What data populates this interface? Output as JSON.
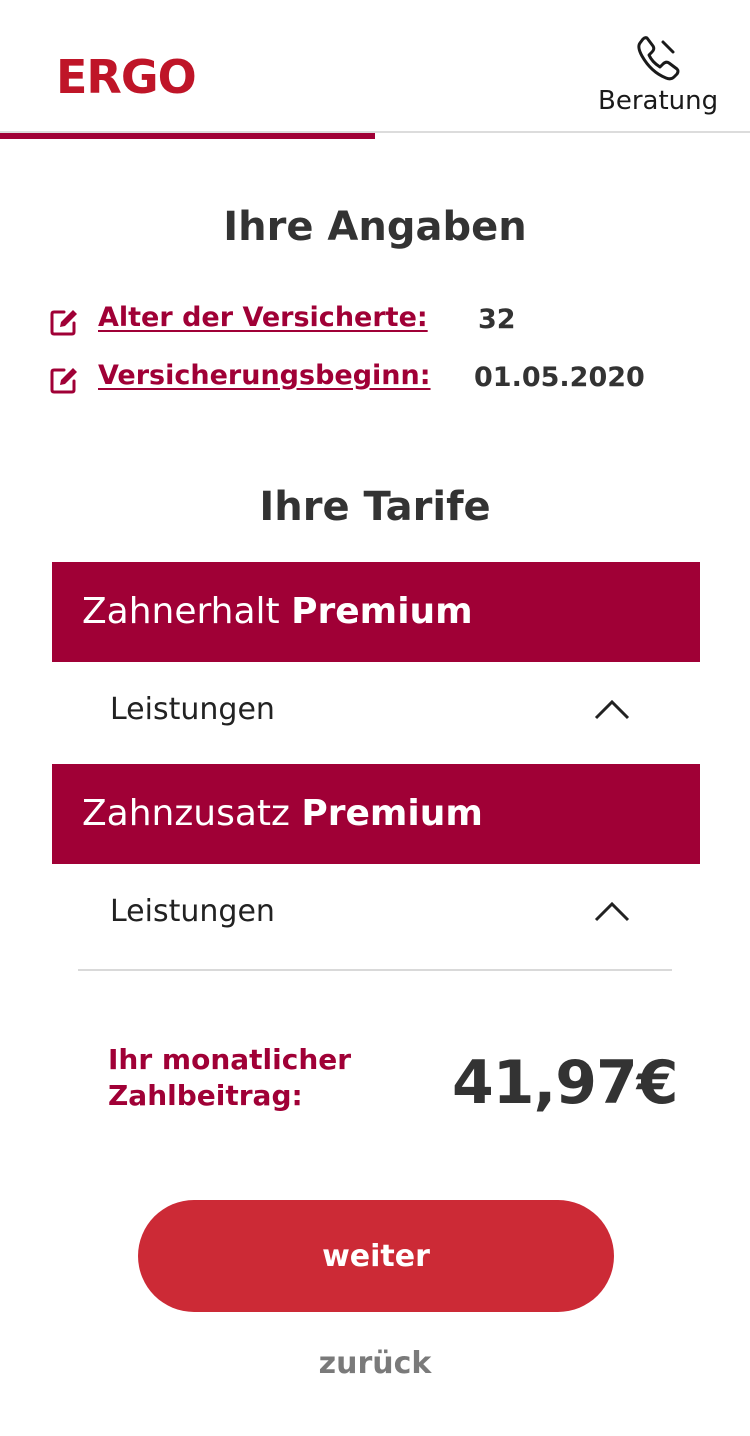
{
  "header": {
    "logo": "ERGO",
    "help_label": "Beratung",
    "help_icon": "phone-icon"
  },
  "progress": {
    "fraction": 0.5
  },
  "details": {
    "title": "Ihre Angaben",
    "rows": [
      {
        "label": "Alter der Versicherte:",
        "value": "32",
        "icon": "edit-icon"
      },
      {
        "label": "Versicherungsbeginn:",
        "value": "01.05.2020",
        "icon": "edit-icon"
      }
    ]
  },
  "tariffs": {
    "title": "Ihre Tarife",
    "items": [
      {
        "name": "Zahnerhalt",
        "level": "Premium",
        "benefits_label": "Leistungen",
        "chevron_icon": "chevron-up-icon"
      },
      {
        "name": "Zahnzusatz",
        "level": "Premium",
        "benefits_label": "Leistungen",
        "chevron_icon": "chevron-up-icon"
      }
    ]
  },
  "price": {
    "label_line1": "Ihr monatlicher",
    "label_line2": "Zahlbeitrag:",
    "value": "41,97€"
  },
  "actions": {
    "next_label": "weiter",
    "back_label": "zurück"
  },
  "colors": {
    "brand_red": "#bf1528",
    "primary": "#a00036",
    "button": "#cc2a36",
    "text": "#333333"
  }
}
